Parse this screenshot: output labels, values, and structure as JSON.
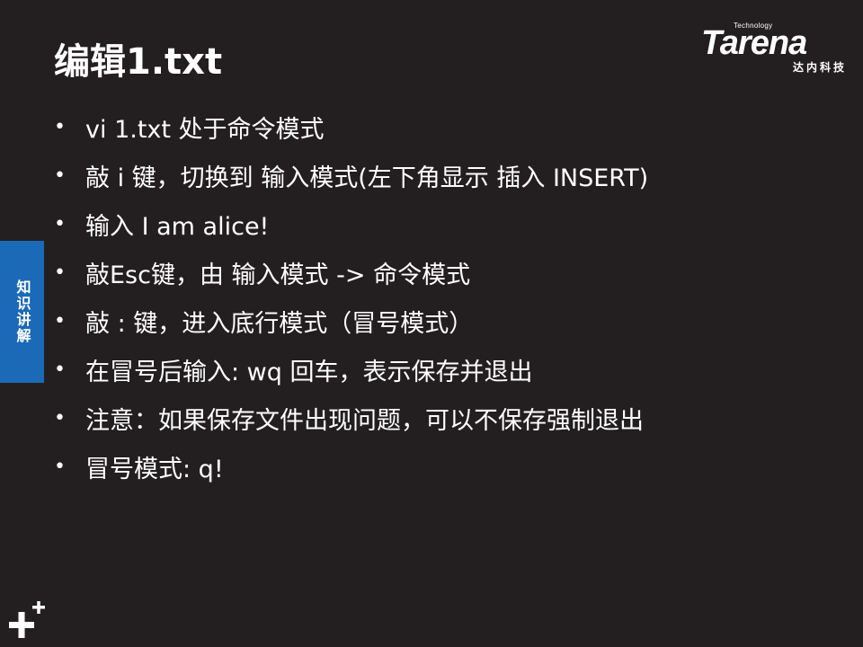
{
  "slide": {
    "title": "编辑1.txt",
    "logo": {
      "small_text": "Technology",
      "brand": "Tarena",
      "subtitle": "达内科技"
    },
    "side_tab": "知识讲解",
    "bullet_symbol": "•",
    "bullets": [
      "vi  1.txt      处于命令模式",
      "敲 i 键，切换到 输入模式(左下角显示 插入 INSERT)",
      "输入 I am alice!",
      "敲Esc键，由 输入模式 -> 命令模式",
      "敲 : 键，进入底行模式（冒号模式）",
      "在冒号后输入: wq 回车，表示保存并退出",
      "注意：如果保存文件出现问题，可以不保存强制退出",
      "冒号模式: q!"
    ]
  },
  "colors": {
    "background": "#231f20",
    "text": "#ffffff",
    "side_tab": "#1b6ab8"
  },
  "icons": {
    "corner_mark": "plus-icon"
  }
}
